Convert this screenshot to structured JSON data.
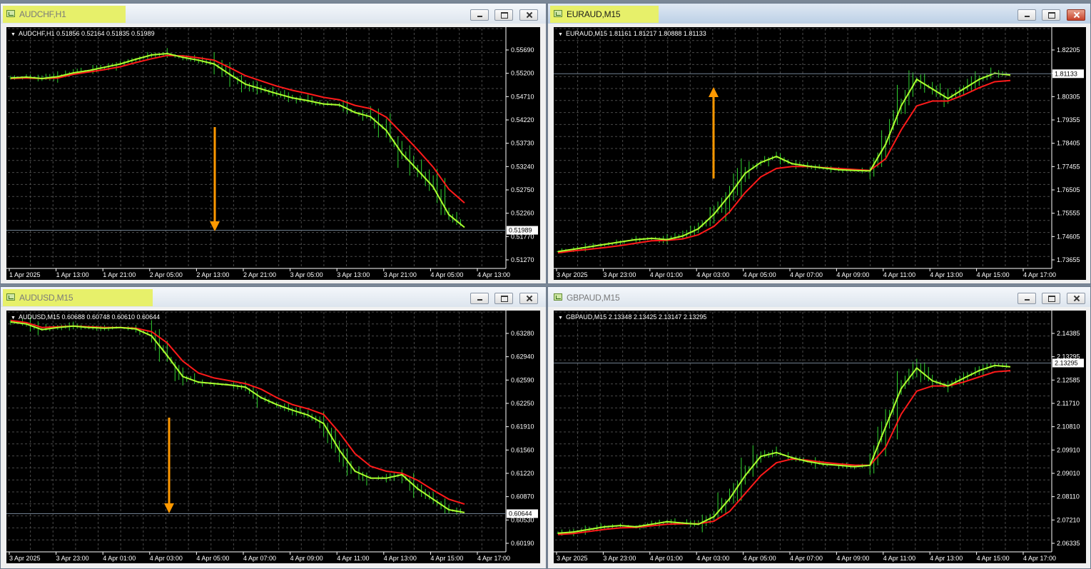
{
  "colors": {
    "plot_bg": "#000000",
    "grid": "#4a4a4a",
    "fast_ma": "#adff2f",
    "slow_ma": "#ff1a1a",
    "candles": "#2fd12f",
    "arrow": "#ff9900",
    "price_line": "#708090"
  },
  "charts": [
    {
      "id": "audchf",
      "window_title": "AUDCHF,H1",
      "info_label": "AUDCHF,H1  0.51856 0.52164 0.51835 0.51989",
      "price_label": "0.51989",
      "arrow": "down",
      "active": false,
      "highlight": true,
      "chart_data": {
        "type": "line",
        "ylim": [
          0.5127,
          0.5618
        ],
        "y_ticks": [
          "0.55690",
          "0.55200",
          "0.54710",
          "0.54220",
          "0.53730",
          "0.53240",
          "0.52750",
          "0.52260",
          "0.51770",
          "0.51270"
        ],
        "x_ticks": [
          "1 Apr 2025",
          "1 Apr 13:00",
          "1 Apr 21:00",
          "2 Apr 05:00",
          "2 Apr 13:00",
          "2 Apr 21:00",
          "3 Apr 05:00",
          "3 Apr 13:00",
          "3 Apr 21:00",
          "4 Apr 05:00",
          "4 Apr 13:00"
        ],
        "current_price": 0.51989,
        "series": [
          {
            "values": [
              0.5522,
              0.5524,
              0.5521,
              0.5525,
              0.5533,
              0.5538,
              0.5545,
              0.5552,
              0.5562,
              0.5571,
              0.5574,
              0.5566,
              0.556,
              0.5552,
              0.553,
              0.5509,
              0.5499,
              0.5489,
              0.548,
              0.5474,
              0.5467,
              0.5465,
              0.5449,
              0.544,
              0.5411,
              0.5362,
              0.5327,
              0.5291,
              0.5232,
              0.5205
            ]
          },
          {
            "values": [
              0.5521,
              0.5522,
              0.5521,
              0.5522,
              0.553,
              0.5535,
              0.554,
              0.5546,
              0.5555,
              0.5563,
              0.557,
              0.5569,
              0.5565,
              0.556,
              0.5544,
              0.5527,
              0.5516,
              0.5505,
              0.5496,
              0.5489,
              0.5481,
              0.5476,
              0.5464,
              0.5457,
              0.5439,
              0.5405,
              0.537,
              0.5333,
              0.5286,
              0.5257
            ]
          }
        ]
      }
    },
    {
      "id": "euraud",
      "window_title": "EURAUD,M15",
      "info_label": "EURAUD,M15  1.81161 1.81217 1.80888 1.81133",
      "price_label": "1.81133",
      "arrow": "up",
      "active": true,
      "highlight": true,
      "chart_data": {
        "type": "line",
        "ylim": [
          1.7323,
          1.8283
        ],
        "y_ticks": [
          "1.82205",
          "1.81133",
          "1.80305",
          "1.79355",
          "1.78405",
          "1.77455",
          "1.76505",
          "1.75555",
          "1.74605",
          "1.73655"
        ],
        "x_ticks": [
          "3 Apr 2025",
          "3 Apr 23:00",
          "4 Apr 01:00",
          "4 Apr 03:00",
          "4 Apr 05:00",
          "4 Apr 07:00",
          "4 Apr 09:00",
          "4 Apr 11:00",
          "4 Apr 13:00",
          "4 Apr 15:00",
          "4 Apr 17:00"
        ],
        "current_price": 1.81133,
        "series": [
          {
            "values": [
              1.7375,
              1.7385,
              1.7395,
              1.7405,
              1.7415,
              1.7425,
              1.743,
              1.7425,
              1.744,
              1.747,
              1.753,
              1.761,
              1.77,
              1.7745,
              1.777,
              1.774,
              1.773,
              1.7722,
              1.7715,
              1.7712,
              1.771,
              1.782,
              1.798,
              1.809,
              1.805,
              1.801,
              1.805,
              1.809,
              1.8115,
              1.8108
            ]
          },
          {
            "values": [
              1.737,
              1.7378,
              1.7385,
              1.7392,
              1.74,
              1.741,
              1.742,
              1.7422,
              1.7428,
              1.7445,
              1.748,
              1.754,
              1.762,
              1.7685,
              1.772,
              1.7728,
              1.7728,
              1.7724,
              1.772,
              1.7716,
              1.7712,
              1.776,
              1.788,
              1.798,
              1.8,
              1.8,
              1.8025,
              1.8055,
              1.808,
              1.8085
            ]
          }
        ]
      }
    },
    {
      "id": "audusd",
      "window_title": "AUDUSD,M15",
      "info_label": "AUDUSD,M15  0.60688 0.60748 0.60610 0.60644",
      "price_label": "0.60644",
      "arrow": "down",
      "active": false,
      "highlight": true,
      "chart_data": {
        "type": "line",
        "ylim": [
          0.6016,
          0.6346
        ],
        "y_ticks": [
          "0.63280",
          "0.62940",
          "0.62590",
          "0.62250",
          "0.61910",
          "0.61560",
          "0.61220",
          "0.60870",
          "0.60530",
          "0.60190"
        ],
        "x_ticks": [
          "3 Apr 2025",
          "3 Apr 23:00",
          "4 Apr 01:00",
          "4 Apr 03:00",
          "4 Apr 05:00",
          "4 Apr 07:00",
          "4 Apr 09:00",
          "4 Apr 11:00",
          "4 Apr 13:00",
          "4 Apr 15:00",
          "4 Apr 17:00"
        ],
        "current_price": 0.60644,
        "series": [
          {
            "values": [
              0.6338,
              0.6335,
              0.6327,
              0.633,
              0.6332,
              0.633,
              0.6329,
              0.633,
              0.6328,
              0.6318,
              0.629,
              0.626,
              0.6252,
              0.625,
              0.6248,
              0.6245,
              0.623,
              0.622,
              0.6212,
              0.6205,
              0.6193,
              0.6155,
              0.6125,
              0.6115,
              0.6115,
              0.612,
              0.61,
              0.6085,
              0.607,
              0.6066
            ]
          },
          {
            "values": [
              0.634,
              0.6337,
              0.633,
              0.6331,
              0.6332,
              0.6331,
              0.633,
              0.633,
              0.6329,
              0.6324,
              0.6308,
              0.6282,
              0.6265,
              0.6258,
              0.6254,
              0.625,
              0.6242,
              0.623,
              0.622,
              0.6214,
              0.6206,
              0.618,
              0.615,
              0.6132,
              0.6125,
              0.6122,
              0.6112,
              0.6098,
              0.6085,
              0.6078
            ]
          }
        ]
      }
    },
    {
      "id": "gbpaud",
      "window_title": "GBPAUD,M15",
      "info_label": "GBPAUD,M15  2.13348 2.13425 2.13147 2.13295",
      "price_label": "2.13295",
      "arrow": "none",
      "active": false,
      "highlight": false,
      "chart_data": {
        "type": "line",
        "ylim": [
          2.0609,
          2.1512
        ],
        "y_ticks": [
          "2.14385",
          "2.13295",
          "2.12585",
          "2.11710",
          "2.10810",
          "2.09910",
          "2.09010",
          "2.08110",
          "2.07210",
          "2.06335"
        ],
        "x_ticks": [
          "3 Apr 2025",
          "3 Apr 23:00",
          "4 Apr 01:00",
          "4 Apr 03:00",
          "4 Apr 05:00",
          "4 Apr 07:00",
          "4 Apr 09:00",
          "4 Apr 11:00",
          "4 Apr 13:00",
          "4 Apr 15:00",
          "4 Apr 17:00"
        ],
        "current_price": 2.13295,
        "series": [
          {
            "values": [
              2.0665,
              2.067,
              2.068,
              2.069,
              2.0695,
              2.069,
              2.07,
              2.071,
              2.0705,
              2.07,
              2.073,
              2.08,
              2.089,
              2.0965,
              2.098,
              2.096,
              2.0945,
              2.0935,
              2.093,
              2.0925,
              2.093,
              2.108,
              2.123,
              2.131,
              2.126,
              2.124,
              2.127,
              2.13,
              2.132,
              2.1315
            ]
          },
          {
            "values": [
              2.066,
              2.0664,
              2.0672,
              2.068,
              2.0686,
              2.0688,
              2.0694,
              2.07,
              2.0702,
              2.0702,
              2.0712,
              2.075,
              2.082,
              2.089,
              2.094,
              2.0955,
              2.095,
              2.0942,
              2.0936,
              2.0931,
              2.093,
              2.1,
              2.113,
              2.122,
              2.124,
              2.124,
              2.1255,
              2.1275,
              2.1295,
              2.13
            ]
          }
        ]
      }
    }
  ]
}
